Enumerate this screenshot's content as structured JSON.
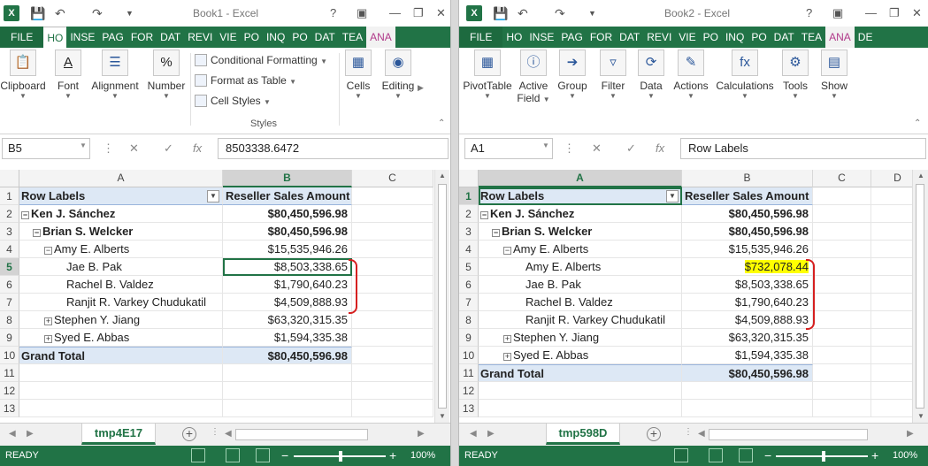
{
  "colors": {
    "excel_green": "#217346",
    "pivot_header": "#dde8f5",
    "highlight": "#ffff00",
    "annotation_red": "#d62020"
  },
  "left": {
    "window_title": "Book1 - Excel",
    "tabs": [
      "FILE",
      "HO",
      "INSE",
      "PAG",
      "FOR",
      "DAT",
      "REVI",
      "VIE",
      "PO",
      "INQ",
      "PO",
      "DAT",
      "TEA",
      "ANA"
    ],
    "ribbon": {
      "clipboard": "Clipboard",
      "font": "Font",
      "alignment": "Alignment",
      "number": "Number",
      "conditional_formatting": "Conditional Formatting",
      "format_as_table": "Format as Table",
      "cell_styles": "Cell Styles",
      "styles_group": "Styles",
      "cells": "Cells",
      "editing": "Editing"
    },
    "name_box": "B5",
    "formula_value": "8503338.6472",
    "columns": [
      "A",
      "B",
      "C"
    ],
    "rows": [
      {
        "n": "1",
        "a": "Row Labels",
        "b": "Reseller Sales Amount",
        "type": "hdr"
      },
      {
        "n": "2",
        "a": "Ken J. Sánchez",
        "b": "$80,450,596.98",
        "type": "bold",
        "level": 0,
        "exp": "−"
      },
      {
        "n": "3",
        "a": "Brian S. Welcker",
        "b": "$80,450,596.98",
        "type": "bold",
        "level": 1,
        "exp": "−"
      },
      {
        "n": "4",
        "a": "Amy E. Alberts",
        "b": "$15,535,946.26",
        "type": "normal",
        "level": 2,
        "exp": "−"
      },
      {
        "n": "5",
        "a": "Jae B. Pak",
        "b": "$8,503,338.65",
        "type": "normal",
        "level": 3
      },
      {
        "n": "6",
        "a": "Rachel B. Valdez",
        "b": "$1,790,640.23",
        "type": "normal",
        "level": 3
      },
      {
        "n": "7",
        "a": "Ranjit R. Varkey Chudukatil",
        "b": "$4,509,888.93",
        "type": "normal",
        "level": 3
      },
      {
        "n": "8",
        "a": "Stephen Y. Jiang",
        "b": "$63,320,315.35",
        "type": "normal",
        "level": 2,
        "exp": "+"
      },
      {
        "n": "9",
        "a": "Syed E. Abbas",
        "b": "$1,594,335.38",
        "type": "normal",
        "level": 2,
        "exp": "+"
      },
      {
        "n": "10",
        "a": "Grand Total",
        "b": "$80,450,596.98",
        "type": "total"
      },
      {
        "n": "11",
        "a": "",
        "b": "",
        "type": "empty"
      },
      {
        "n": "12",
        "a": "",
        "b": "",
        "type": "empty"
      },
      {
        "n": "13",
        "a": "",
        "b": "",
        "type": "empty"
      }
    ],
    "sheet_tab": "tmp4E17",
    "status_ready": "READY",
    "zoom": "100%"
  },
  "right": {
    "window_title": "Book2 - Excel",
    "tabs": [
      "FILE",
      "HO",
      "INSE",
      "PAG",
      "FOR",
      "DAT",
      "REVI",
      "VIE",
      "PO",
      "INQ",
      "PO",
      "DAT",
      "TEA",
      "ANA",
      "DE"
    ],
    "ribbon": {
      "pivot_table": "PivotTable",
      "active_field_1": "Active",
      "active_field_2": "Field",
      "group": "Group",
      "filter": "Filter",
      "data": "Data",
      "actions": "Actions",
      "calculations": "Calculations",
      "tools": "Tools",
      "show": "Show"
    },
    "name_box": "A1",
    "formula_value": "Row Labels",
    "columns": [
      "A",
      "B",
      "C",
      "D"
    ],
    "rows": [
      {
        "n": "1",
        "a": "Row Labels",
        "b": "Reseller Sales Amount",
        "type": "hdr"
      },
      {
        "n": "2",
        "a": "Ken J. Sánchez",
        "b": "$80,450,596.98",
        "type": "bold",
        "level": 0,
        "exp": "−"
      },
      {
        "n": "3",
        "a": "Brian S. Welcker",
        "b": "$80,450,596.98",
        "type": "bold",
        "level": 1,
        "exp": "−"
      },
      {
        "n": "4",
        "a": "Amy E. Alberts",
        "b": "$15,535,946.26",
        "type": "normal",
        "level": 2,
        "exp": "−"
      },
      {
        "n": "5",
        "a": "Amy E. Alberts",
        "b": "$732,078.44",
        "type": "highlight",
        "level": 3
      },
      {
        "n": "6",
        "a": "Jae B. Pak",
        "b": "$8,503,338.65",
        "type": "normal",
        "level": 3
      },
      {
        "n": "7",
        "a": "Rachel B. Valdez",
        "b": "$1,790,640.23",
        "type": "normal",
        "level": 3
      },
      {
        "n": "8",
        "a": "Ranjit R. Varkey Chudukatil",
        "b": "$4,509,888.93",
        "type": "normal",
        "level": 3
      },
      {
        "n": "9",
        "a": "Stephen Y. Jiang",
        "b": "$63,320,315.35",
        "type": "normal",
        "level": 2,
        "exp": "+"
      },
      {
        "n": "10",
        "a": "Syed E. Abbas",
        "b": "$1,594,335.38",
        "type": "normal",
        "level": 2,
        "exp": "+"
      },
      {
        "n": "11",
        "a": "Grand Total",
        "b": "$80,450,596.98",
        "type": "total"
      },
      {
        "n": "12",
        "a": "",
        "b": "",
        "type": "empty"
      },
      {
        "n": "13",
        "a": "",
        "b": "",
        "type": "empty"
      }
    ],
    "sheet_tab": "tmp598D",
    "status_ready": "READY",
    "zoom": "100%"
  }
}
